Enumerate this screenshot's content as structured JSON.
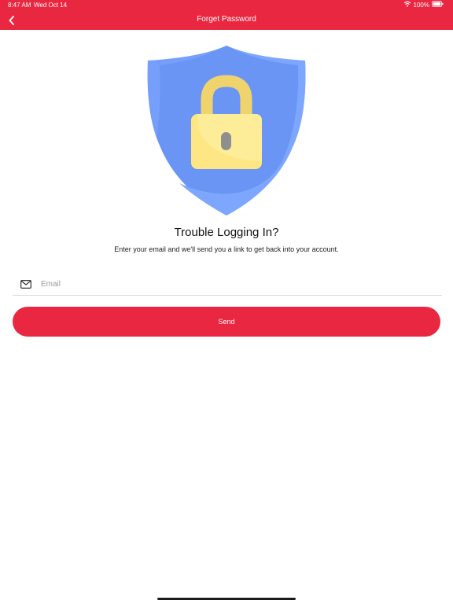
{
  "status_bar": {
    "time": "8:47 AM",
    "date": "Wed Oct 14",
    "battery": "100%"
  },
  "nav": {
    "title": "Forget Password",
    "back_icon": "chevron-left-icon"
  },
  "illustration": {
    "icon": "shield-lock-icon",
    "colors": {
      "shield": "#7da7ff",
      "shield_shade": "#6b95f5",
      "lock_body": "#fde683",
      "lock_shackle": "#efd46d",
      "keyhole": "#8f8f8f"
    }
  },
  "content": {
    "headline": "Trouble Logging In?",
    "subtext": "Enter your email and we'll send you a link to get back into your account."
  },
  "form": {
    "email_icon": "mail-icon",
    "email_placeholder": "Email",
    "email_value": "",
    "send_label": "Send"
  },
  "theme": {
    "accent": "#ea2741"
  }
}
